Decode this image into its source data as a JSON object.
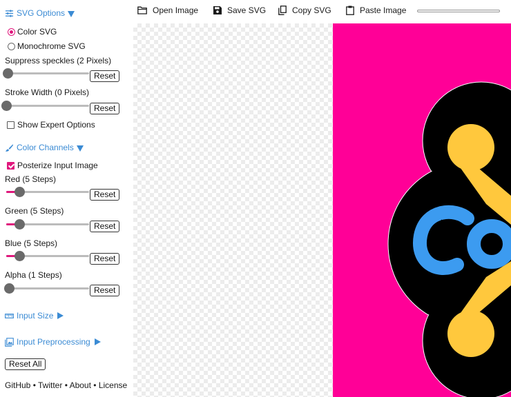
{
  "sidebar": {
    "svg_options": {
      "label": "SVG Options"
    },
    "color_svg_label": "Color SVG",
    "mono_svg_label": "Monochrome SVG",
    "color_mode": "color",
    "speckles": {
      "label": "Suppress speckles (2 Pixels)",
      "value": 2,
      "max": 128,
      "reset": "Reset"
    },
    "stroke": {
      "label": "Stroke Width (0 Pixels)",
      "value": 0,
      "max": 20,
      "reset": "Reset"
    },
    "expert_label": "Show Expert Options",
    "expert_checked": false,
    "color_channels": {
      "label": "Color Channels"
    },
    "posterize_label": "Posterize Input Image",
    "posterize_checked": true,
    "red": {
      "label": "Red (5 Steps)",
      "value": 5,
      "max": 32,
      "reset": "Reset"
    },
    "green": {
      "label": "Green (5 Steps)",
      "value": 5,
      "max": 32,
      "reset": "Reset"
    },
    "blue": {
      "label": "Blue (5 Steps)",
      "value": 5,
      "max": 32,
      "reset": "Reset"
    },
    "alpha": {
      "label": "Alpha (1 Steps)",
      "value": 1,
      "max": 32,
      "reset": "Reset"
    },
    "input_size": {
      "label": "Input Size"
    },
    "input_preprocessing": {
      "label": "Input Preprocessing"
    },
    "reset_all": "Reset All"
  },
  "footer": {
    "github": "GitHub",
    "twitter": "Twitter",
    "about": "About",
    "license": "License",
    "sep": " • "
  },
  "toolbar": {
    "open": "Open Image",
    "save": "Save SVG",
    "copy": "Copy SVG",
    "paste": "Paste Image",
    "progress": 0
  },
  "colors": {
    "accent": "#e0187d",
    "link": "#3b8bd4",
    "art_bg": "#ff0097",
    "art_outline": "#000000",
    "art_yellow": "#ffc83d",
    "art_blue": "#3c9bf0"
  }
}
